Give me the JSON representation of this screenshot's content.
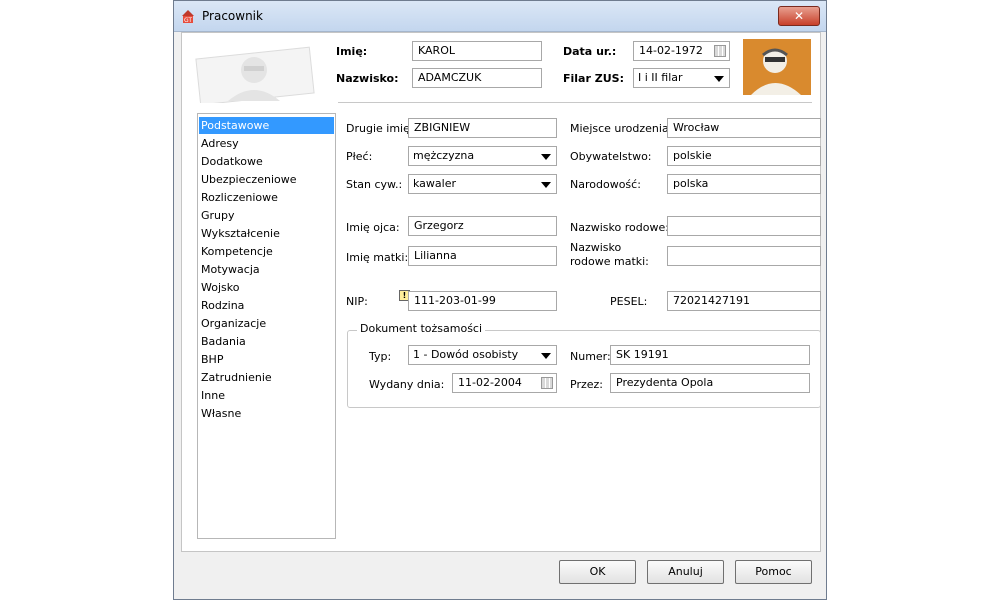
{
  "window": {
    "title": "Pracownik",
    "close_label": "✕"
  },
  "header": {
    "imie_label": "Imię:",
    "imie_value": "KAROL",
    "nazwisko_label": "Nazwisko:",
    "nazwisko_value": "ADAMCZUK",
    "data_ur_label": "Data ur.:",
    "data_ur_value": "14-02-1972",
    "filar_label": "Filar ZUS:",
    "filar_value": "I i II filar"
  },
  "sidebar": {
    "items": [
      {
        "label": "Podstawowe",
        "selected": true
      },
      {
        "label": "Adresy"
      },
      {
        "label": "Dodatkowe"
      },
      {
        "label": "Ubezpieczeniowe"
      },
      {
        "label": "Rozliczeniowe"
      },
      {
        "label": "Grupy"
      },
      {
        "label": "Wykształcenie"
      },
      {
        "label": "Kompetencje"
      },
      {
        "label": "Motywacja"
      },
      {
        "label": "Wojsko"
      },
      {
        "label": "Rodzina"
      },
      {
        "label": "Organizacje"
      },
      {
        "label": "Badania"
      },
      {
        "label": "BHP"
      },
      {
        "label": "Zatrudnienie"
      },
      {
        "label": "Inne"
      },
      {
        "label": "Własne"
      }
    ]
  },
  "form": {
    "drugie_imie_label": "Drugie imię:",
    "drugie_imie_value": "ZBIGNIEW",
    "plec_label": "Płeć:",
    "plec_value": "mężczyzna",
    "stan_label": "Stan cyw.:",
    "stan_value": "kawaler",
    "miejsce_label": "Miejsce urodzenia:",
    "miejsce_value": "Wrocław",
    "obywatelstwo_label": "Obywatelstwo:",
    "obywatelstwo_value": "polskie",
    "narodowosc_label": "Narodowość:",
    "narodowosc_value": "polska",
    "imie_ojca_label": "Imię ojca:",
    "imie_ojca_value": "Grzegorz",
    "imie_matki_label": "Imię matki:",
    "imie_matki_value": "Lilianna",
    "nazwisko_rodowe_label": "Nazwisko rodowe:",
    "nazwisko_rodowe_value": "",
    "nazwisko_rodowe_matki_label_1": "Nazwisko",
    "nazwisko_rodowe_matki_label_2": "rodowe matki:",
    "nazwisko_rodowe_matki_value": "",
    "nip_label": "NIP:",
    "nip_value": "111-203-01-99",
    "pesel_label": "PESEL:",
    "pesel_value": "72021427191"
  },
  "document": {
    "legend": "Dokument tożsamości",
    "typ_label": "Typ:",
    "typ_value": "1 - Dowód osobisty",
    "numer_label": "Numer:",
    "numer_value": "SK 19191",
    "wydany_label": "Wydany dnia:",
    "wydany_value": "11-02-2004",
    "przez_label": "Przez:",
    "przez_value": "Prezydenta Opola"
  },
  "buttons": {
    "ok": "OK",
    "cancel": "Anuluj",
    "help": "Pomoc"
  },
  "colors": {
    "selection": "#3399ff",
    "close": "#c8402a",
    "photo": "#d98a2e"
  }
}
